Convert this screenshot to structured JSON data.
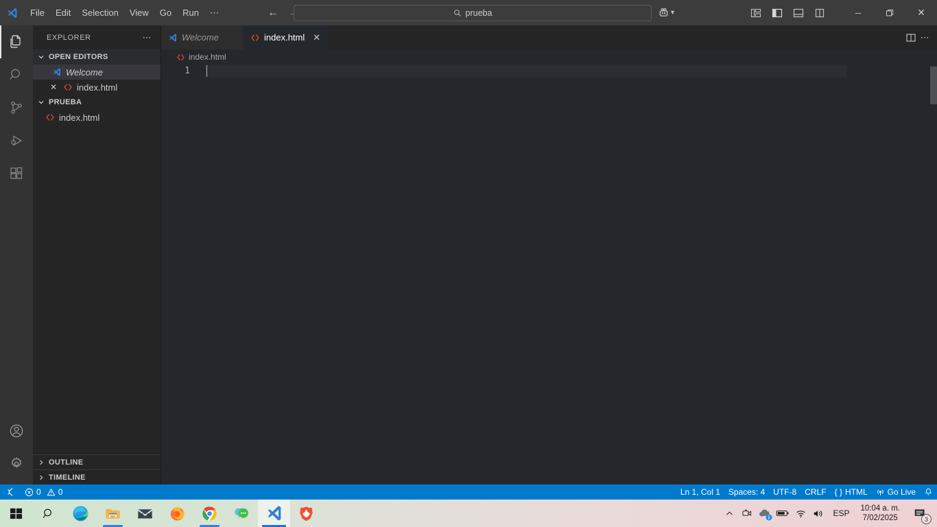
{
  "titlebar": {
    "logo_icon": "vscode-logo-icon",
    "menus": [
      "File",
      "Edit",
      "Selection",
      "View",
      "Go",
      "Run"
    ],
    "menu_overflow": "⋯",
    "nav_back_icon": "arrow-left-icon",
    "nav_forward_icon": "arrow-right-icon",
    "quick_input": {
      "value": "prueba",
      "placeholder": "Search",
      "icon": "search-icon"
    },
    "remote_icon": "remote-account-icon",
    "remote_chevron": "chevron-down-icon",
    "layout_buttons": [
      {
        "name": "customize-layout",
        "icon": "layout-customize-icon"
      },
      {
        "name": "toggle-primary-sidebar",
        "icon": "panel-left-icon"
      },
      {
        "name": "toggle-panel",
        "icon": "panel-bottom-icon"
      },
      {
        "name": "toggle-secondary-sidebar",
        "icon": "panel-right-icon"
      }
    ],
    "window_minimize": "─",
    "window_maximize": "❐",
    "window_close": "✕"
  },
  "activitybar": {
    "items": [
      {
        "name": "explorer",
        "icon": "files-icon",
        "active": true
      },
      {
        "name": "search",
        "icon": "search-icon",
        "active": false
      },
      {
        "name": "source-control",
        "icon": "source-control-icon",
        "active": false
      },
      {
        "name": "run-and-debug",
        "icon": "run-debug-icon",
        "active": false
      },
      {
        "name": "extensions",
        "icon": "extensions-icon",
        "active": false
      }
    ],
    "bottom_items": [
      {
        "name": "accounts",
        "icon": "account-icon"
      },
      {
        "name": "manage-settings",
        "icon": "gear-icon"
      }
    ]
  },
  "sidebar": {
    "title": "EXPLORER",
    "actions_icon": "ellipsis-icon",
    "open_editors": {
      "label": "OPEN EDITORS",
      "chevron": "chevron-down-icon",
      "items": [
        {
          "label": "Welcome",
          "icon": "vscode-logo-icon",
          "italic": true,
          "selected": true,
          "dirty": false
        },
        {
          "label": "index.html",
          "icon": "html-icon",
          "italic": false,
          "selected": false,
          "close": "✕"
        }
      ]
    },
    "folder": {
      "label": "PRUEBA",
      "chevron": "chevron-down-icon",
      "items": [
        {
          "label": "index.html",
          "icon": "html-icon"
        }
      ]
    },
    "outline": {
      "label": "OUTLINE",
      "chevron": "chevron-right-icon"
    },
    "timeline": {
      "label": "TIMELINE",
      "chevron": "chevron-right-icon"
    }
  },
  "editor": {
    "tabs": [
      {
        "label": "Welcome",
        "icon": "vscode-logo-icon",
        "active": false,
        "italic": true
      },
      {
        "label": "index.html",
        "icon": "html-icon",
        "active": true,
        "italic": false,
        "close": "✕"
      }
    ],
    "tab_actions": [
      {
        "name": "split-editor-right",
        "icon": "split-editor-icon"
      },
      {
        "name": "more-editor-actions",
        "icon": "ellipsis-icon"
      }
    ],
    "breadcrumb": {
      "icon": "html-icon",
      "label": "index.html"
    },
    "line_numbers": [
      "1"
    ],
    "content_lines": [
      ""
    ]
  },
  "statusbar": {
    "remote_icon": "remote-host-icon",
    "errors_icon": "error-icon",
    "errors": "0",
    "warnings_icon": "warning-icon",
    "warnings": "0",
    "cursor_position": "Ln 1, Col 1",
    "indentation": "Spaces: 4",
    "encoding": "UTF-8",
    "eol": "CRLF",
    "language_icon": "braces-icon",
    "language": "HTML",
    "golive_icon": "broadcast-icon",
    "golive": "Go Live",
    "bell_icon": "bell-icon",
    "background_color": "#007acc"
  },
  "taskbar": {
    "apps": [
      {
        "name": "start-button",
        "icon": "windows-logo-icon",
        "running": false,
        "active": false
      },
      {
        "name": "search-taskbar",
        "icon": "search-icon",
        "running": false,
        "active": false
      },
      {
        "name": "microsoft-edge",
        "icon": "edge-icon",
        "running": false,
        "active": false
      },
      {
        "name": "file-explorer",
        "icon": "folder-icon",
        "running": true,
        "active": false
      },
      {
        "name": "mail",
        "icon": "mail-icon",
        "running": false,
        "active": false
      },
      {
        "name": "firefox",
        "icon": "firefox-icon",
        "running": false,
        "active": false
      },
      {
        "name": "google-chrome",
        "icon": "chrome-icon",
        "running": true,
        "active": false
      },
      {
        "name": "chat-app",
        "icon": "chat-bubble-icon",
        "running": false,
        "active": false
      },
      {
        "name": "visual-studio-code",
        "icon": "vscode-logo-icon",
        "running": true,
        "active": true
      },
      {
        "name": "brave-browser",
        "icon": "brave-lion-icon",
        "running": false,
        "active": false
      }
    ],
    "tray": {
      "overflow_icon": "chevron-up-icon",
      "icons": [
        {
          "name": "camera-tray-icon",
          "icon": "camera-icon"
        },
        {
          "name": "onedrive-tray-icon",
          "icon": "cloud-info-icon"
        },
        {
          "name": "battery-tray-icon",
          "icon": "battery-icon"
        },
        {
          "name": "network-tray-icon",
          "icon": "wifi-icon"
        },
        {
          "name": "volume-tray-icon",
          "icon": "speaker-icon"
        }
      ],
      "language": "ESP",
      "time": "10:04 a. m.",
      "date": "7/02/2025",
      "notifications_icon": "notification-icon",
      "notifications_count": "3"
    }
  }
}
